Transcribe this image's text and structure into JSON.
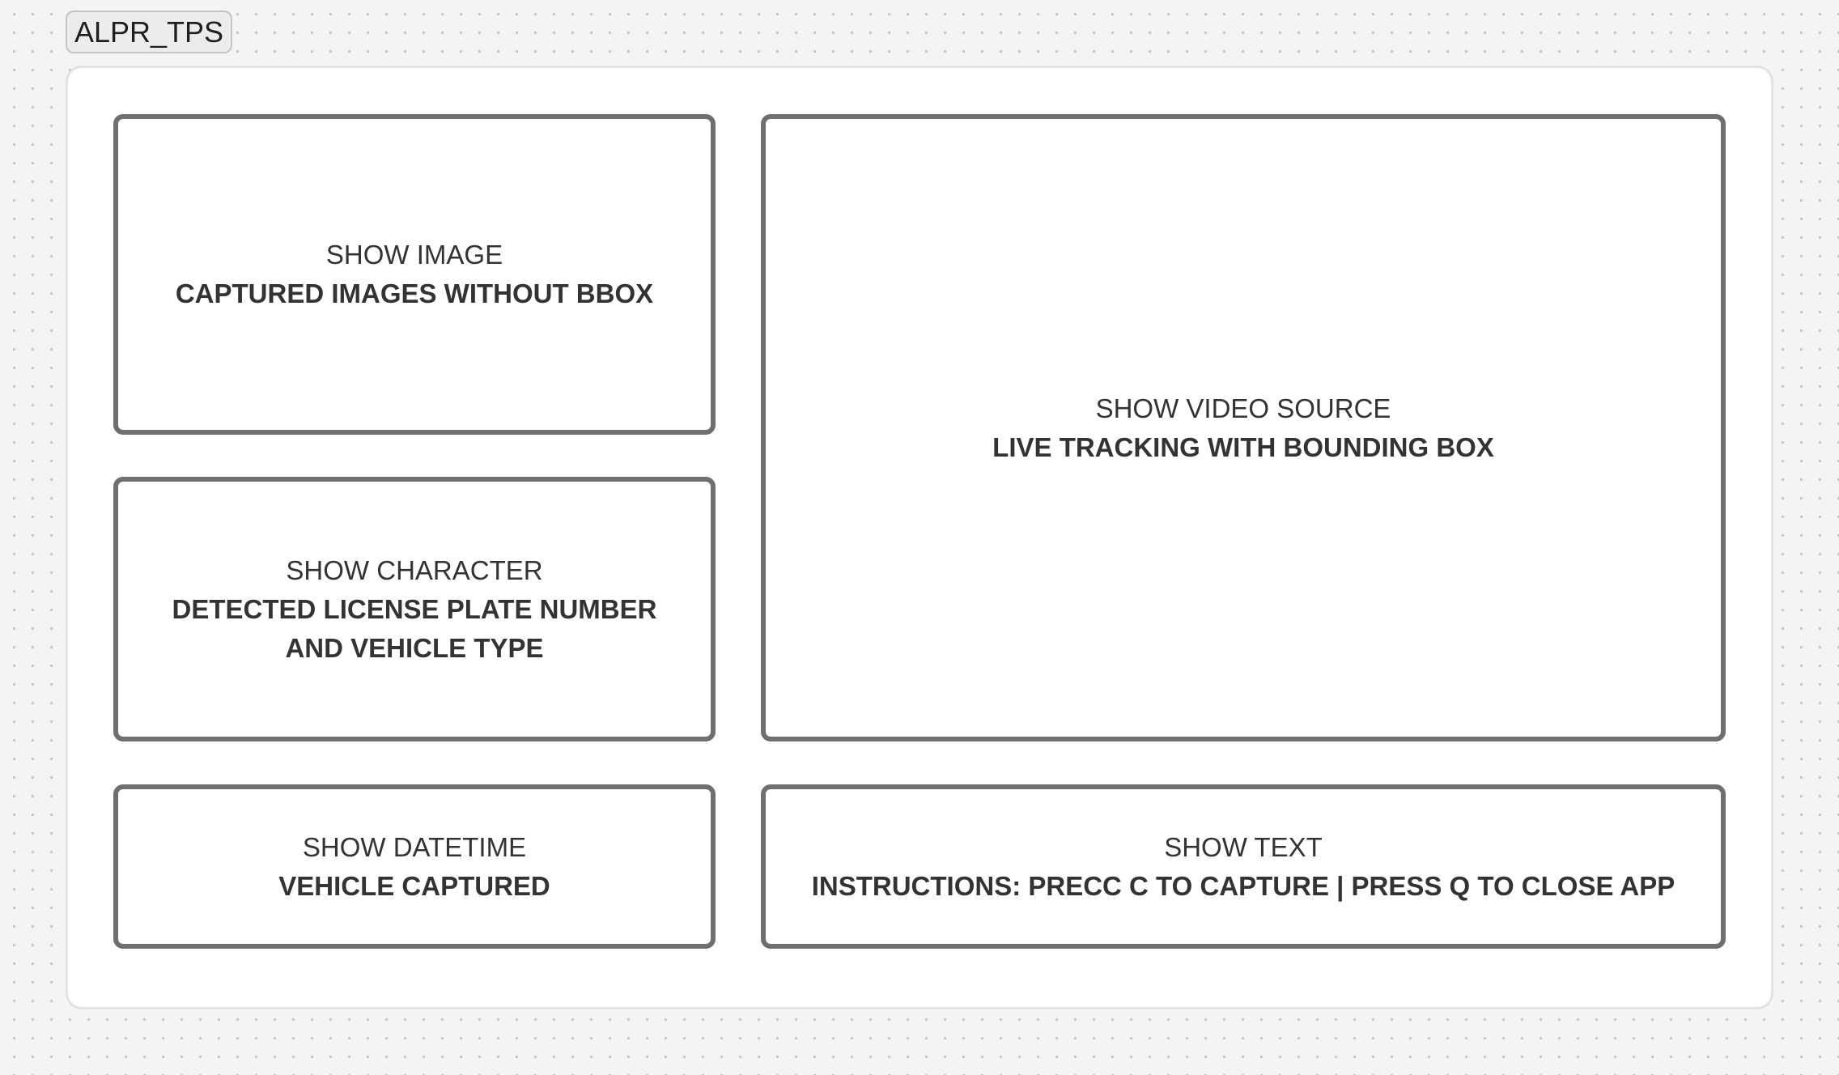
{
  "frame": {
    "title": "ALPR_TPS"
  },
  "panels": {
    "image": {
      "title": "SHOW IMAGE",
      "desc": "CAPTURED IMAGES WITHOUT BBOX"
    },
    "character": {
      "title": "SHOW CHARACTER",
      "desc": "DETECTED LICENSE PLATE NUMBER AND VEHICLE TYPE"
    },
    "video": {
      "title": "SHOW VIDEO SOURCE",
      "desc": "LIVE TRACKING WITH BOUNDING BOX"
    },
    "datetime": {
      "title": "SHOW DATETIME",
      "desc": "VEHICLE CAPTURED"
    },
    "text": {
      "title": "SHOW TEXT",
      "desc": "INSTRUCTIONS: PRECC C TO CAPTURE | PRESS Q TO CLOSE APP"
    }
  }
}
